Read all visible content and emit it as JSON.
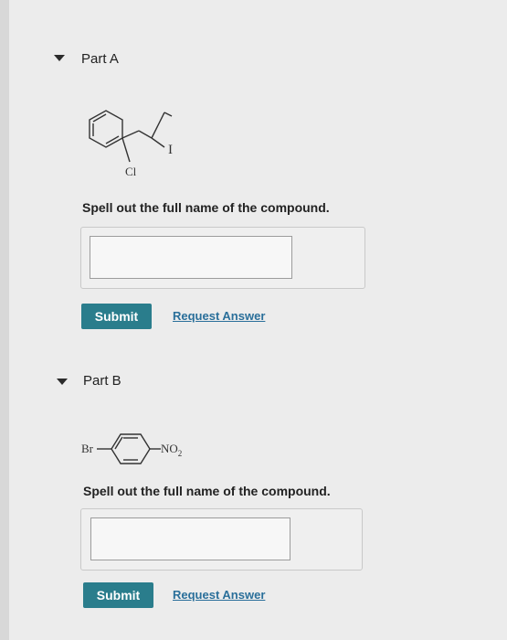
{
  "parts": [
    {
      "title": "Part A",
      "molecule": {
        "substituent_1": "I",
        "substituent_2": "Cl"
      },
      "prompt": "Spell out the full name of the compound.",
      "input_value": "",
      "submit_label": "Submit",
      "request_label": "Request Answer"
    },
    {
      "title": "Part B",
      "molecule": {
        "left_group": "Br",
        "right_group": "NO",
        "right_group_subscript": "2"
      },
      "prompt": "Spell out the full name of the compound.",
      "input_value": "",
      "submit_label": "Submit",
      "request_label": "Request Answer"
    }
  ],
  "colors": {
    "accent": "#2a7d8c",
    "link": "#2a6f9a",
    "background": "#ececec"
  }
}
